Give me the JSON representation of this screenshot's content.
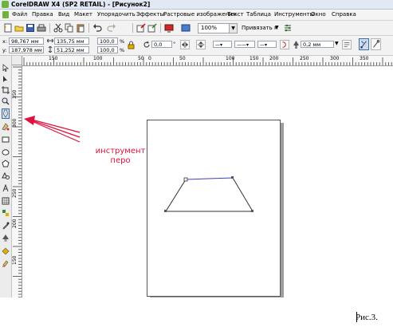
{
  "window": {
    "title": "CorelDRAW X4 (SP2 RETAIL) - [Рисунок2]"
  },
  "menu": [
    "Файл",
    "Правка",
    "Вид",
    "Макет",
    "Упорядочить",
    "Эффекты",
    "Растровые изображения",
    "Текст",
    "Таблица",
    "Инструменты",
    "Окно",
    "Справка"
  ],
  "toolbar": {
    "zoom_value": "100%",
    "snap_label": "Привязать к"
  },
  "property_bar": {
    "x_label": "x:",
    "x_value": "98,767 мм",
    "y_label": "y:",
    "y_value": "187,978 мм",
    "width_value": "135,75 мм",
    "height_value": "51,252 мм",
    "scale_x": "100,0",
    "scale_y": "100,0",
    "percent": "%",
    "rotation": "0,0",
    "rotation_unit": "°",
    "outline_width": "0,2 мм"
  },
  "ruler": {
    "h_labels": [
      "150",
      "100",
      "50",
      "0",
      "50",
      "100",
      "150",
      "200",
      "250",
      "300",
      "350"
    ],
    "v_labels": [
      "350",
      "300",
      "250",
      "200",
      "150"
    ]
  },
  "annotation": {
    "line1": "инструмент",
    "line2": "перо"
  },
  "caption": "Рис.3.",
  "colors": {
    "annotation": "#e0103a",
    "selected_segment": "#4040c0",
    "active_tool": "#3a6ea5"
  },
  "icons": [
    "app-logo-icon",
    "new-icon",
    "open-icon",
    "save-icon",
    "print-icon",
    "cut-icon",
    "copy-icon",
    "paste-icon",
    "undo-icon",
    "redo-icon",
    "import-icon",
    "export-icon",
    "pick-tool-icon",
    "shape-tool-icon",
    "crop-tool-icon",
    "zoom-tool-icon",
    "pen-tool-icon",
    "smart-fill-icon",
    "rectangle-tool-icon",
    "ellipse-tool-icon",
    "polygon-tool-icon",
    "basic-shapes-icon",
    "text-tool-icon",
    "table-tool-icon",
    "interactive-blend-icon",
    "eyedropper-icon",
    "outline-tool-icon",
    "fill-tool-icon",
    "interactive-fill-icon"
  ]
}
